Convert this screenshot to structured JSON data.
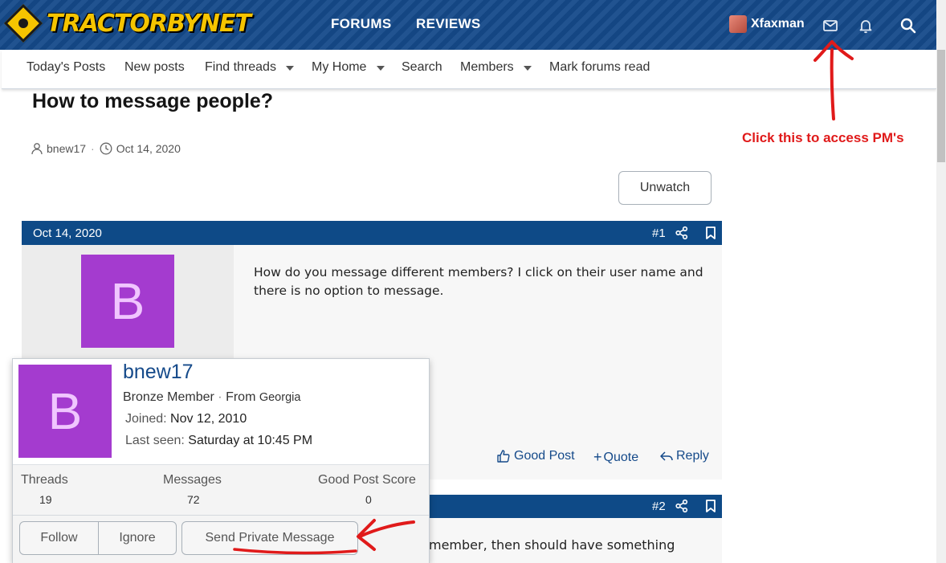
{
  "header": {
    "logo_text": "TRACTORBYNET",
    "nav": [
      "FORUMS",
      "REVIEWS"
    ],
    "username": "Xfaxman",
    "icons": [
      "envelope-icon",
      "bell-icon",
      "search-icon"
    ]
  },
  "subnav": {
    "items": [
      {
        "label": "Today's Posts",
        "dropdown": false
      },
      {
        "label": "New posts",
        "dropdown": false
      },
      {
        "label": "Find threads",
        "dropdown": true
      },
      {
        "label": "My Home",
        "dropdown": true
      },
      {
        "label": "Search",
        "dropdown": false
      },
      {
        "label": "Members",
        "dropdown": true
      },
      {
        "label": "Mark forums read",
        "dropdown": false
      }
    ]
  },
  "thread": {
    "title": "How to message people?",
    "author": "bnew17",
    "date": "Oct 14, 2020",
    "unwatch_label": "Unwatch"
  },
  "annotation": {
    "text": "Click this to access PM's",
    "color": "#e01a1a"
  },
  "post1": {
    "date": "Oct 14, 2020",
    "number": "#1",
    "avatar_letter": "B",
    "message": "How do you message different members? I click on their user name and there is no option to message.",
    "actions": [
      "Good Post",
      "Quote",
      "Reply"
    ]
  },
  "post2": {
    "number": "#2",
    "message_fragment": "member, then should have something"
  },
  "member_card": {
    "avatar_letter": "B",
    "username": "bnew17",
    "rank": "Bronze Member",
    "from_label": "From",
    "location": "Georgia",
    "joined_label": "Joined:",
    "joined_value": "Nov 12, 2010",
    "last_seen_label": "Last seen:",
    "last_seen_value": "Saturday at 10:45 PM",
    "stats": [
      {
        "label": "Threads",
        "value": "19"
      },
      {
        "label": "Messages",
        "value": "72"
      },
      {
        "label": "Good Post Score",
        "value": "0"
      }
    ],
    "buttons": {
      "follow": "Follow",
      "ignore": "Ignore",
      "send_pm": "Send Private Message"
    }
  },
  "colors": {
    "header_bg": "#154a8a",
    "post_bar": "#0e4a87",
    "avatar": "#a43bcf",
    "accent_link": "#154a8a"
  }
}
